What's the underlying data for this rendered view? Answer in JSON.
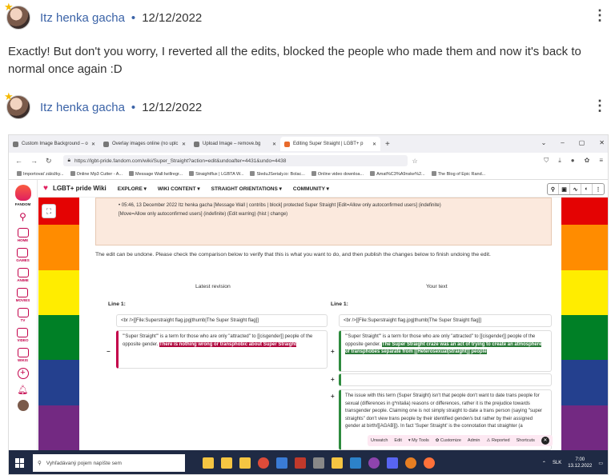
{
  "posts": [
    {
      "author": "Itz henka gacha",
      "separator": "•",
      "date": "12/12/2022",
      "text": "Exactly! But don't you worry, I reverted all the edits, blocked the people who made them and now it's back to normal once again :D"
    },
    {
      "author": "Itz henka gacha",
      "separator": "•",
      "date": "12/12/2022"
    }
  ],
  "screenshot": {
    "tabs": [
      {
        "label": "Custom Image Background – o"
      },
      {
        "label": "Overlay images online (no uplc"
      },
      {
        "label": "Upload Image – remove.bg"
      },
      {
        "label": "Editing Super Straight | LGBT+ p"
      }
    ],
    "url": "https://lgbt-pride.fandom.com/wiki/Super_Straight?action=edit&undoafter=4431&undo=4438",
    "bookmarks": [
      "Importovať záložky...",
      "Online Mp3 Cutter - A...",
      "Message Wall:Iwillregr...",
      "Straightflux | LGBTA W...",
      "SleduJSerialy.io: Bolac...",
      "Online video downloa...",
      "Amat%C3%A9nske%2...",
      "The Blog of Epic Rand..."
    ],
    "wiki": {
      "name": "LGBT+ pride Wiki",
      "menus": [
        "EXPLORE ▾",
        "WIKI CONTENT ▾",
        "STRAIGHT ORIENTATIONS ▾",
        "COMMUNITY ▾"
      ],
      "rail": [
        "FANDOM",
        "HOME",
        "GAMES",
        "ANIME",
        "MOVIES",
        "TV",
        "VIDEO",
        "WIKIS"
      ],
      "log_line1": "• 05:46, 13 December 2022 Itz henka gacha [Message Wall | contribs | block] protected Super Straight [Edit=Allow only autoconfirmed users] (indefinite)",
      "log_line2": "[Move=Allow only autoconfirmed users] (indefinite) (Edit warring) (hist | change)",
      "undo_note": "The edit can be undone. Please check the comparison below to verify that this is what you want to do, and then publish the changes below to finish undoing the edit.",
      "col_latest": "Latest revision",
      "col_yours": "Your text",
      "line_label": "Line 1:",
      "file_line": "<br />[[File:Superstraight flag.jpg|thumb|The Super Straight flag]]",
      "left_text": "'''Super Straight''' is a term for those who are only \"attracted\" to [[cisgender]] people of the opposite gender.",
      "left_deleted": "There is nothing wrong or transphobic about Super Straight",
      "right_text": "'''Super Straight''' is a term for those who are only \"attracted\" to [[cisgender]] people of the opposite gender.",
      "right_added": "The Super Straight craze was an act of trying to create an atmosphere of transphobes separate from [[Heterosexual|straight]] people",
      "right_para": "The issue with this term (Super Straight) isn't that people don't want to date trans people for sexual (differences in g*nitalia) reasons or differences, rather it is the prejudice towards transgender people. Claiming one is not simply straight to date a trans person (saying \"super straights\" don't view trans people by their identified gender/s but rather by their assigned gender at birth/[[AGAB]]). In fact 'Super Straight' is the connotation that straighter (a",
      "bottom_bar": [
        "Unwatch",
        "Edit",
        "▾ My Tools",
        "✿ Customize",
        "Admin",
        "⚠ Reported",
        "Shortcuts"
      ]
    },
    "taskbar": {
      "search_placeholder": "Vyhľadávaný pojem napíšte sem",
      "lang": "SLK",
      "time": "7:00",
      "date": "13.12.2022"
    }
  },
  "colors": {
    "link": "#3b63a7",
    "fandom_accent": "#c3004a",
    "pride_flag": [
      "#e40303",
      "#ff8c00",
      "#ffed00",
      "#008026",
      "#24408e",
      "#732982"
    ]
  }
}
